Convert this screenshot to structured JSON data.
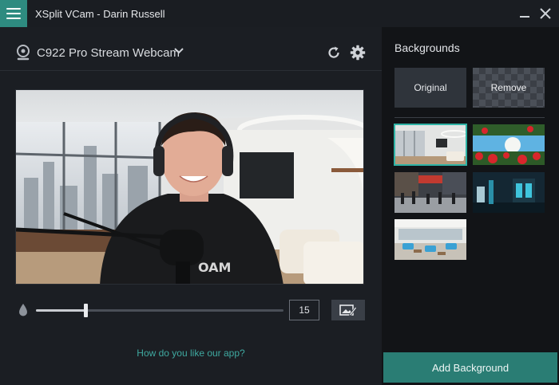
{
  "window": {
    "title": "XSplit VCam - Darin Russell"
  },
  "camera": {
    "name": "C922 Pro Stream Webcam"
  },
  "blur": {
    "value": "15",
    "level_fraction": 0.2
  },
  "feedback": {
    "link_text": "How do you like our app?"
  },
  "backgrounds": {
    "heading": "Backgrounds",
    "original_label": "Original",
    "remove_label": "Remove",
    "add_button_label": "Add Background"
  },
  "colors": {
    "accent": "#2e8b80",
    "selected_outline": "#2fb3a5",
    "link": "#3fa9a0"
  },
  "icons": {
    "menu": "hamburger-menu-icon",
    "camera": "webcam-icon",
    "refresh": "refresh-icon",
    "settings": "gear-icon",
    "blur": "droplet-icon",
    "edit_background": "image-edit-icon"
  }
}
